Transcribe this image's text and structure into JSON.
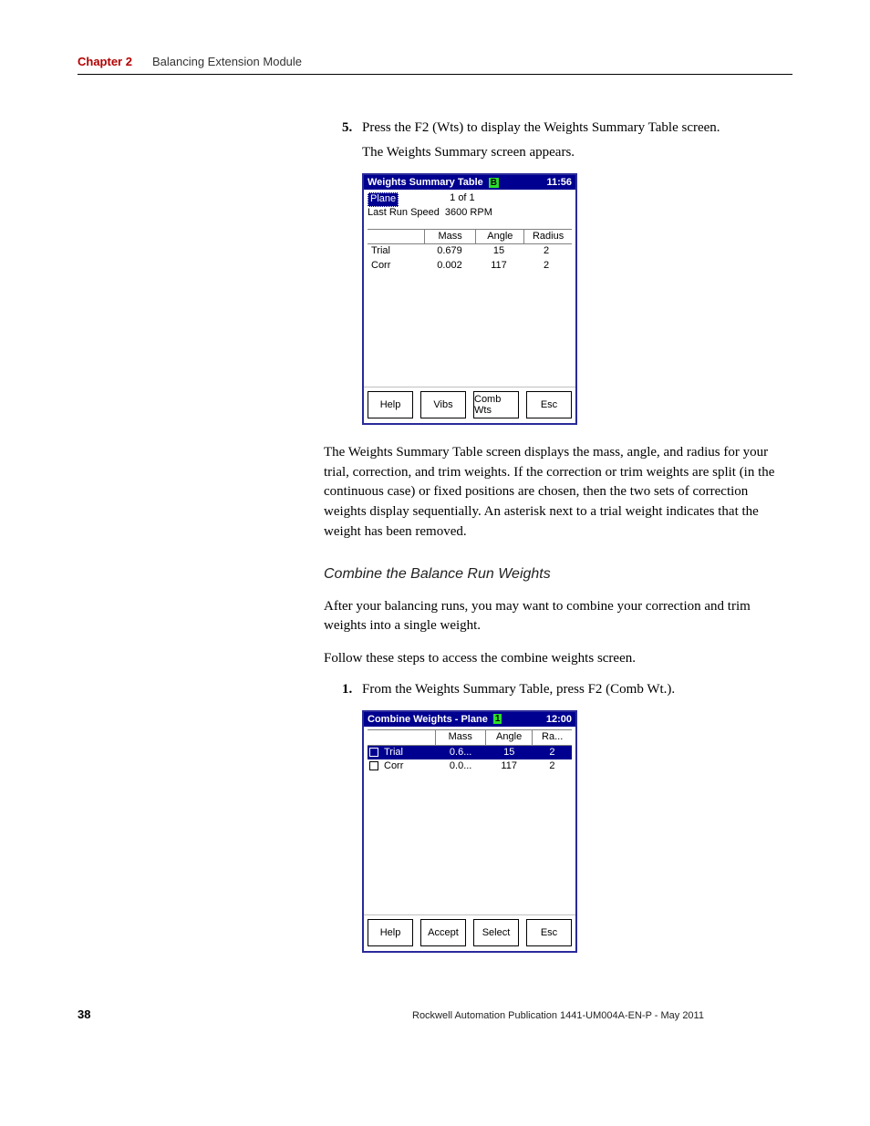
{
  "header": {
    "chapter_label": "Chapter 2",
    "chapter_title": "Balancing Extension Module"
  },
  "steps": {
    "s5_num": "5.",
    "s5_text": "Press the F2 (Wts) to display the Weights Summary Table screen.",
    "s5_after": "The Weights Summary screen appears.",
    "s1_num": "1.",
    "s1_text": "From the Weights Summary Table, press F2 (Comb Wt.)."
  },
  "body": {
    "p1": "The Weights Summary Table screen displays the mass, angle, and radius for your trial, correction, and trim weights. If the correction or trim weights are split (in the continuous case) or fixed positions are chosen, then the two sets of correction weights display sequentially. An asterisk next to a trial weight indicates that the weight has been removed.",
    "h1": "Combine the Balance Run Weights",
    "p2": "After your balancing runs, you may want to combine your correction and trim weights into a single weight.",
    "p3": "Follow these steps to access the combine weights screen."
  },
  "dev1": {
    "title": "Weights Summary Table",
    "batt": "B",
    "time": "11:56",
    "plane_label": "Plane",
    "plane_count": "1 of 1",
    "speed_label": "Last Run Speed",
    "speed_value": "3600 RPM",
    "headers": {
      "mass": "Mass",
      "angle": "Angle",
      "radius": "Radius"
    },
    "rows": [
      {
        "label": "Trial",
        "mass": "0.679",
        "angle": "15",
        "radius": "2"
      },
      {
        "label": "Corr",
        "mass": "0.002",
        "angle": "117",
        "radius": "2"
      }
    ],
    "buttons": {
      "b1": "Help",
      "b2": "Vibs",
      "b3": "Comb Wts",
      "b4": "Esc"
    }
  },
  "dev2": {
    "title": "Combine Weights - Plane",
    "batt": "1",
    "time": "12:00",
    "headers": {
      "mass": "Mass",
      "angle": "Angle",
      "radius": "Ra..."
    },
    "rows": [
      {
        "sel": true,
        "label": "Trial",
        "mass": "0.6...",
        "angle": "15",
        "radius": "2"
      },
      {
        "sel": false,
        "label": "Corr",
        "mass": "0.0...",
        "angle": "117",
        "radius": "2"
      }
    ],
    "buttons": {
      "b1": "Help",
      "b2": "Accept",
      "b3": "Select",
      "b4": "Esc"
    }
  },
  "footer": {
    "page": "38",
    "pub": "Rockwell Automation Publication 1441-UM004A-EN-P - May 2011"
  }
}
